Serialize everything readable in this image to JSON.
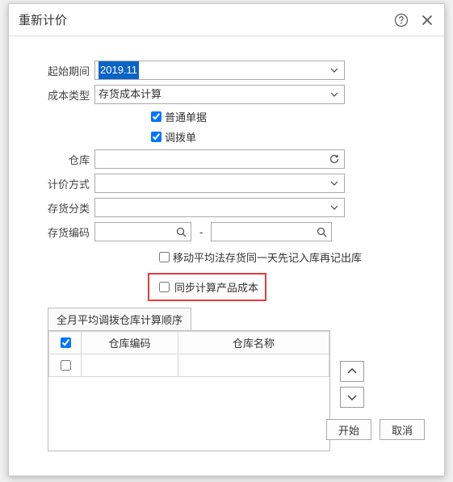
{
  "dialog": {
    "title": "重新计价"
  },
  "form": {
    "period_label": "起始期间",
    "period_value": "2019.11",
    "cost_type_label": "成本类型",
    "cost_type_value": "存货成本计算",
    "normal_doc_label": "普通单据",
    "transfer_doc_label": "调拨单",
    "warehouse_label": "仓库",
    "warehouse_value": "",
    "pricing_method_label": "计价方式",
    "pricing_method_value": "",
    "stock_category_label": "存货分类",
    "stock_category_value": "",
    "stock_code_label": "存货编码",
    "stock_code_from": "",
    "stock_code_to": "",
    "ma_check_label": "移动平均法存货同一天先记入库再记出库",
    "sync_check_label": "同步计算产品成本"
  },
  "tab": {
    "label": "全月平均调拨仓库计算顺序"
  },
  "table": {
    "col_code": "仓库编码",
    "col_name": "仓库名称"
  },
  "footer": {
    "start": "开始",
    "cancel": "取消"
  }
}
